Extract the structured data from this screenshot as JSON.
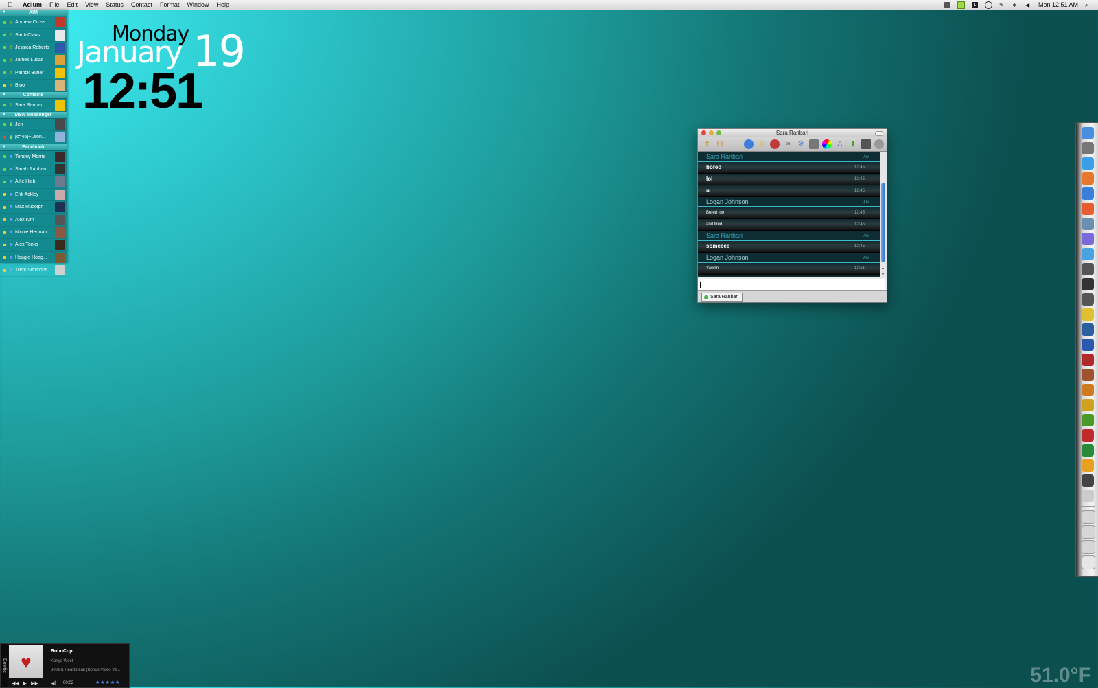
{
  "menubar": {
    "apple_icon": "apple-icon",
    "app_name": "Adium",
    "items": [
      "File",
      "Edit",
      "View",
      "Status",
      "Contact",
      "Format",
      "Window",
      "Help"
    ],
    "clock": "Mon 12:51 AM"
  },
  "contact_list": {
    "groups": [
      {
        "name": "AIM",
        "contacts": [
          {
            "name": "Andrew Cross",
            "service": "aim",
            "status": "available"
          },
          {
            "name": "SantaClaus",
            "service": "aim",
            "status": "available"
          },
          {
            "name": "Jessica Roberts",
            "service": "aim",
            "status": "available"
          },
          {
            "name": "James Lucas",
            "service": "aim",
            "status": "available"
          },
          {
            "name": "Patrick Butler",
            "service": "aim",
            "status": "available"
          },
          {
            "name": "Bioo",
            "service": "aim",
            "status": "away"
          }
        ]
      },
      {
        "name": "Contacts",
        "contacts": [
          {
            "name": "Sara Ranbari",
            "service": "aim",
            "status": "available"
          }
        ]
      },
      {
        "name": "MSN Messenger",
        "contacts": [
          {
            "name": "Jen",
            "service": "msn",
            "status": "available"
          },
          {
            "name": "[c=46]~Leon...",
            "service": "msn",
            "status": "busy"
          }
        ]
      },
      {
        "name": "Facebook",
        "contacts": [
          {
            "name": "Tommy Morris",
            "service": "facebook",
            "status": "available"
          },
          {
            "name": "Sarah Rahbari",
            "service": "facebook",
            "status": "available"
          },
          {
            "name": "Allie Hieb",
            "service": "facebook",
            "status": "available"
          },
          {
            "name": "Erik Ackley",
            "service": "facebook",
            "status": "away"
          },
          {
            "name": "Max Rudolph",
            "service": "facebook",
            "status": "away"
          },
          {
            "name": "Alex Kim",
            "service": "facebook",
            "status": "away"
          },
          {
            "name": "Nicole Herman",
            "service": "facebook",
            "status": "away"
          },
          {
            "name": "Alex Tonks",
            "service": "facebook",
            "status": "away"
          },
          {
            "name": "Hoagie Hoag...",
            "service": "facebook",
            "status": "away"
          },
          {
            "name": "Trent Simmons",
            "service": "facebook",
            "status": "away"
          }
        ]
      }
    ]
  },
  "clock_widget": {
    "day": "Monday",
    "month": "January",
    "date": "19",
    "time": "12:51"
  },
  "chat_window": {
    "title": "Sara Ranbari",
    "blocks": [
      {
        "sender": "Sara Ranbari",
        "who": "sara",
        "service": "AIM",
        "messages": [
          {
            "text": "bored",
            "time": "12:45",
            "style": "bold"
          },
          {
            "text": "lol",
            "time": "12:45",
            "style": "bold"
          },
          {
            "text": "u",
            "time": "12:45",
            "style": "bold"
          }
        ]
      },
      {
        "sender": "Logan Johnson",
        "who": "logan",
        "service": "AIM",
        "messages": [
          {
            "text": "Bored too",
            "time": "12:45",
            "style": "small"
          },
          {
            "text": "and tired..",
            "time": "12:45",
            "style": "small"
          }
        ]
      },
      {
        "sender": "Sara Ranbari",
        "who": "sara",
        "service": "AIM",
        "messages": [
          {
            "text": "someeee",
            "time": "12:45",
            "style": "bold"
          }
        ]
      },
      {
        "sender": "Logan Johnson",
        "who": "logan",
        "service": "AIM",
        "messages": [
          {
            "text": "Yawnn",
            "time": "12:51",
            "style": "small"
          }
        ]
      }
    ],
    "input_value": "",
    "tab_label": "Sara Ranbari"
  },
  "player": {
    "sidebar_label": "Bowtie",
    "title": "RoboCop",
    "artist": "Kanye West",
    "album": "808s & Heartbreak (Bonus Video Ve...",
    "time": "00:02",
    "rating_stars": 5,
    "stars": "★★★★★"
  },
  "temperature": "51.0°F"
}
